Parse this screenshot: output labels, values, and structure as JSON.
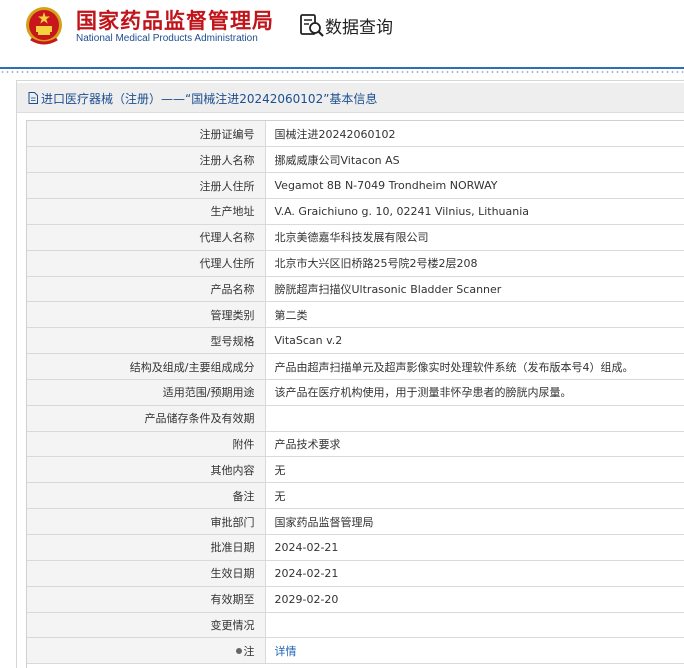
{
  "header": {
    "title_cn": "国家药品监督管理局",
    "title_en": "National Medical Products Administration",
    "query_label": "数据查询"
  },
  "page": {
    "title": "进口医疗器械（注册）——“国械注进20242060102”基本信息"
  },
  "rows": [
    {
      "label": "注册证编号",
      "value": "国械注进20242060102"
    },
    {
      "label": "注册人名称",
      "value": "挪威威康公司Vitacon AS"
    },
    {
      "label": "注册人住所",
      "value": "Vegamot 8B N-7049 Trondheim NORWAY"
    },
    {
      "label": "生产地址",
      "value": "V.A. Graichiuno g. 10, 02241 Vilnius, Lithuania"
    },
    {
      "label": "代理人名称",
      "value": "北京美德嘉华科技发展有限公司"
    },
    {
      "label": "代理人住所",
      "value": "北京市大兴区旧桥路25号院2号楼2层208"
    },
    {
      "label": "产品名称",
      "value": "膀胱超声扫描仪Ultrasonic Bladder Scanner"
    },
    {
      "label": "管理类别",
      "value": "第二类"
    },
    {
      "label": "型号规格",
      "value": "VitaScan v.2"
    },
    {
      "label": "结构及组成/主要组成成分",
      "value": "产品由超声扫描单元及超声影像实时处理软件系统（发布版本号4）组成。"
    },
    {
      "label": "适用范围/预期用途",
      "value": "该产品在医疗机构使用，用于测量非怀孕患者的膀胱内尿量。"
    },
    {
      "label": "产品储存条件及有效期",
      "value": ""
    },
    {
      "label": "附件",
      "value": "产品技术要求"
    },
    {
      "label": "其他内容",
      "value": "无"
    },
    {
      "label": "备注",
      "value": "无"
    },
    {
      "label": "审批部门",
      "value": "国家药品监督管理局"
    },
    {
      "label": "批准日期",
      "value": "2024-02-21"
    },
    {
      "label": "生效日期",
      "value": "2024-02-21"
    },
    {
      "label": "有效期至",
      "value": "2029-02-20"
    },
    {
      "label": "变更情况",
      "value": ""
    }
  ],
  "note_row": {
    "label": "注",
    "link": "详情"
  },
  "colors": {
    "brand_red": "#c0141a",
    "brand_blue": "#1d4e8f",
    "link": "#1d62b7"
  }
}
